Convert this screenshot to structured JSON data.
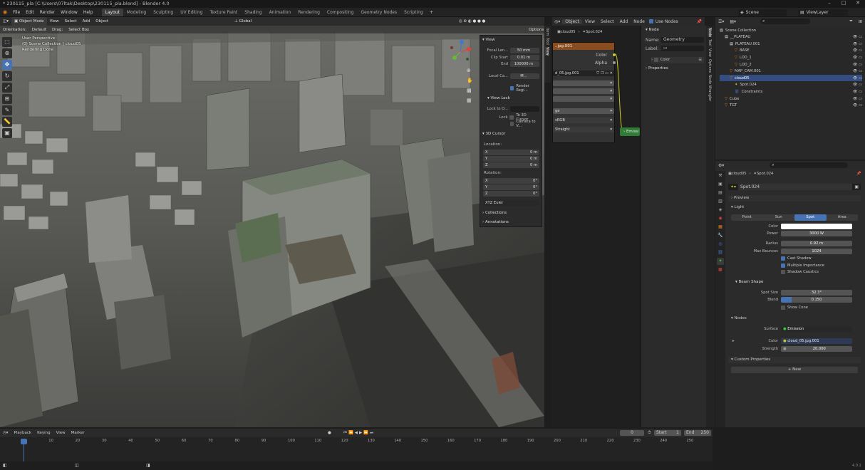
{
  "titlebar": {
    "title": "* 230115_pla [C:\\Users\\07ltak\\Desktop\\230115_pla.blend] - Blender 4.0"
  },
  "menu": {
    "items": [
      "File",
      "Edit",
      "Render",
      "Window",
      "Help"
    ]
  },
  "workspaces": [
    "Layout",
    "Modeling",
    "Sculpting",
    "UV Editing",
    "Texture Paint",
    "Shading",
    "Animation",
    "Rendering",
    "Compositing",
    "Geometry Nodes",
    "Scripting"
  ],
  "active_workspace": "Layout",
  "topright": {
    "scene": "Scene",
    "view_layer": "ViewLayer"
  },
  "viewport": {
    "mode": "Object Mode",
    "menu": [
      "View",
      "Select",
      "Add",
      "Object"
    ],
    "orientation_label": "Orientation:",
    "orientation": "Default",
    "drag_label": "Drag:",
    "drag": "Select Box",
    "transform": "Global",
    "options": "Options",
    "info": [
      "User Perspective",
      "(0) Scene Collection | cloud05",
      "Rendering Done"
    ]
  },
  "npanel": {
    "view_title": "View",
    "focal_label": "Focal Len...",
    "focal": "50 mm",
    "clip_start_label": "Clip Start",
    "clip_start": "0.01 m",
    "end_label": "End",
    "end": "100000 m",
    "local_camera_label": "Local Ca...",
    "local_camera": "M...",
    "render_region": "Render Regi...",
    "view_lock_title": "View Lock",
    "lock_to_label": "Lock to O...",
    "lock_label": "Lock",
    "to_3d_cursor": "To 3D Cursor",
    "camera_to_view": "Camera to V...",
    "cursor_title": "3D Cursor",
    "location_label": "Location:",
    "rotation_label": "Rotation:",
    "loc": [
      {
        "axis": "X",
        "value": "0 m"
      },
      {
        "axis": "Y",
        "value": "0 m"
      },
      {
        "axis": "Z",
        "value": "0 m"
      }
    ],
    "rot": [
      {
        "axis": "X",
        "value": "0°"
      },
      {
        "axis": "Y",
        "value": "0°"
      },
      {
        "axis": "Z",
        "value": "0°"
      }
    ],
    "rot_mode": "XYZ Euler",
    "collections": "Collections",
    "annotations": "Annotations",
    "tabs": [
      "Item",
      "Tool",
      "View"
    ]
  },
  "node_editor": {
    "header": [
      "Object",
      "View",
      "Select",
      "Add",
      "Node"
    ],
    "use_nodes": "Use Nodes",
    "breadcrumb_obj": "cloud05",
    "breadcrumb_light": "Spot.024",
    "image_node_title": "..jpg.001",
    "out_color": "Color",
    "out_alpha": "Alpha",
    "image_name": "d_05.jpg.001",
    "colorspace": "sRGB",
    "alpha": "Straight",
    "partial": "ge",
    "emission": "Emissi",
    "side_tabs": [
      "Node",
      "Tool",
      "View",
      "Options",
      "Node Wrangler"
    ],
    "props": {
      "node_title": "Node",
      "name_label": "Name:",
      "name": "Geometry",
      "label_label": "Label:",
      "color": "Color",
      "properties": "Properties"
    }
  },
  "outliner": {
    "search_placeholder": "",
    "rows": [
      {
        "name": "Scene Collection",
        "indent": 0
      },
      {
        "name": "__PLATEAU",
        "indent": 1
      },
      {
        "name": "PLATEAU.001",
        "indent": 2
      },
      {
        "name": "BASE",
        "indent": 3
      },
      {
        "name": "LOD_1",
        "indent": 3
      },
      {
        "name": "LOD_2",
        "indent": 3
      },
      {
        "name": "MAP_CAM.001",
        "indent": 2
      },
      {
        "name": "cloud05",
        "indent": 2,
        "selected": true
      },
      {
        "name": "Spot.024",
        "indent": 3
      },
      {
        "name": "Constraints",
        "indent": 3
      },
      {
        "name": "Cube",
        "indent": 1
      },
      {
        "name": "TGT",
        "indent": 1
      }
    ]
  },
  "properties": {
    "breadcrumb_obj": "cloud05",
    "breadcrumb_light": "Spot.024",
    "data_name": "Spot.024",
    "preview": "Preview",
    "light": "Light",
    "light_types": [
      "Point",
      "Sun",
      "Spot",
      "Area"
    ],
    "active_light_type": "Spot",
    "fields": [
      {
        "label": "Color",
        "value": ""
      },
      {
        "label": "Power",
        "value": "3000 W"
      },
      {
        "label": "Radius",
        "value": "0.92 m"
      },
      {
        "label": "Max Bounces",
        "value": "1024"
      }
    ],
    "checks": [
      {
        "label": "Cast Shadow",
        "on": true
      },
      {
        "label": "Multiple Importance",
        "on": true
      },
      {
        "label": "Shadow Caustics",
        "on": false
      }
    ],
    "beam_shape": "Beam Shape",
    "spot_size_label": "Spot Size",
    "spot_size": "32.3°",
    "blend_label": "Blend",
    "blend": "0.150",
    "show_cone": "Show Cone",
    "nodes": "Nodes",
    "surface_label": "Surface",
    "surface": "Emission",
    "color_label": "Color",
    "color_tex": "cloud_05.jpg.001",
    "strength_label": "Strength",
    "strength": "20.000",
    "custom_props": "Custom Properties",
    "new_button": "New"
  },
  "timeline": {
    "menu": [
      "Playback",
      "Keying",
      "View",
      "Marker"
    ],
    "current": "0",
    "start_label": "Start",
    "start": "1",
    "end_label": "End",
    "end": "250",
    "ticks": [
      "0",
      "10",
      "20",
      "30",
      "40",
      "50",
      "60",
      "70",
      "80",
      "90",
      "100",
      "110",
      "120",
      "130",
      "140",
      "150",
      "160",
      "170",
      "180",
      "190",
      "200",
      "210",
      "220",
      "230",
      "240",
      "250"
    ]
  },
  "version": "4.0.1",
  "colors": {
    "accent": "#4772b3",
    "selected": "#334d80",
    "node_image_header": "#8a4d1f",
    "emission_node": "#2f7a34"
  }
}
